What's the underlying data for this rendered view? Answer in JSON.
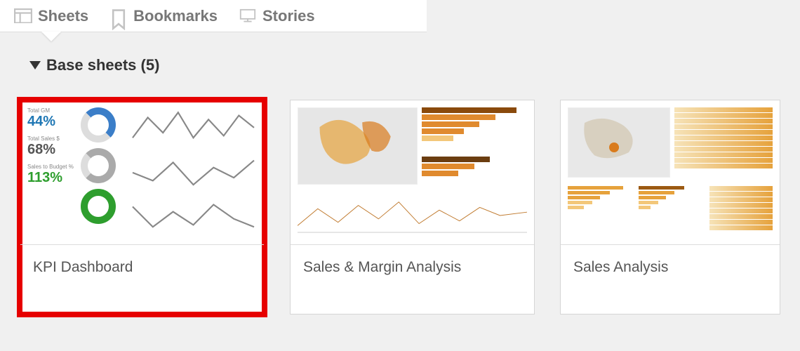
{
  "tabs": {
    "sheets": "Sheets",
    "bookmarks": "Bookmarks",
    "stories": "Stories"
  },
  "section": {
    "title": "Base sheets (5)"
  },
  "cards": {
    "kpi": {
      "title": "KPI Dashboard",
      "kpi1_label": "Total GM",
      "kpi1_value": "44%",
      "kpi2_label": "Total Sales $",
      "kpi2_value": "68%",
      "kpi3_label": "Sales to Budget %",
      "kpi3_value": "113%"
    },
    "sm": {
      "title": "Sales & Margin Analysis"
    },
    "sa": {
      "title": "Sales Analysis"
    }
  }
}
